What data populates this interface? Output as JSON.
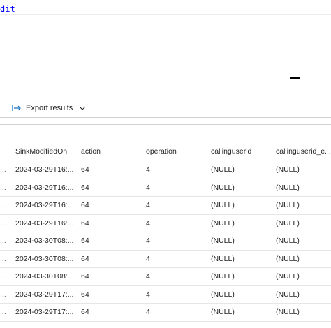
{
  "editor": {
    "query_text": "dit"
  },
  "toolbar": {
    "export_label": "Export results"
  },
  "icons": {
    "export": "export-arrow-icon",
    "dropdown": "chevron-down-icon"
  },
  "colors": {
    "editor_text": "#0000ff",
    "accent": "#0f6cbd"
  },
  "results": {
    "columns": [
      "",
      "SinkModifiedOn",
      "action",
      "operation",
      "callinguserid",
      "callinguserid_e..."
    ],
    "rows": [
      [
        "...",
        "2024-03-29T16:...",
        "64",
        "4",
        "(NULL)",
        "(NULL)"
      ],
      [
        "...",
        "2024-03-29T16:...",
        "64",
        "4",
        "(NULL)",
        "(NULL)"
      ],
      [
        "...",
        "2024-03-29T16:...",
        "64",
        "4",
        "(NULL)",
        "(NULL)"
      ],
      [
        "...",
        "2024-03-29T16:...",
        "64",
        "4",
        "(NULL)",
        "(NULL)"
      ],
      [
        "...",
        "2024-03-30T08:...",
        "64",
        "4",
        "(NULL)",
        "(NULL)"
      ],
      [
        "...",
        "2024-03-30T08:...",
        "64",
        "4",
        "(NULL)",
        "(NULL)"
      ],
      [
        "...",
        "2024-03-30T08:...",
        "64",
        "4",
        "(NULL)",
        "(NULL)"
      ],
      [
        "...",
        "2024-03-29T17:...",
        "64",
        "4",
        "(NULL)",
        "(NULL)"
      ],
      [
        "...",
        "2024-03-29T17:...",
        "64",
        "4",
        "(NULL)",
        "(NULL)"
      ]
    ]
  }
}
